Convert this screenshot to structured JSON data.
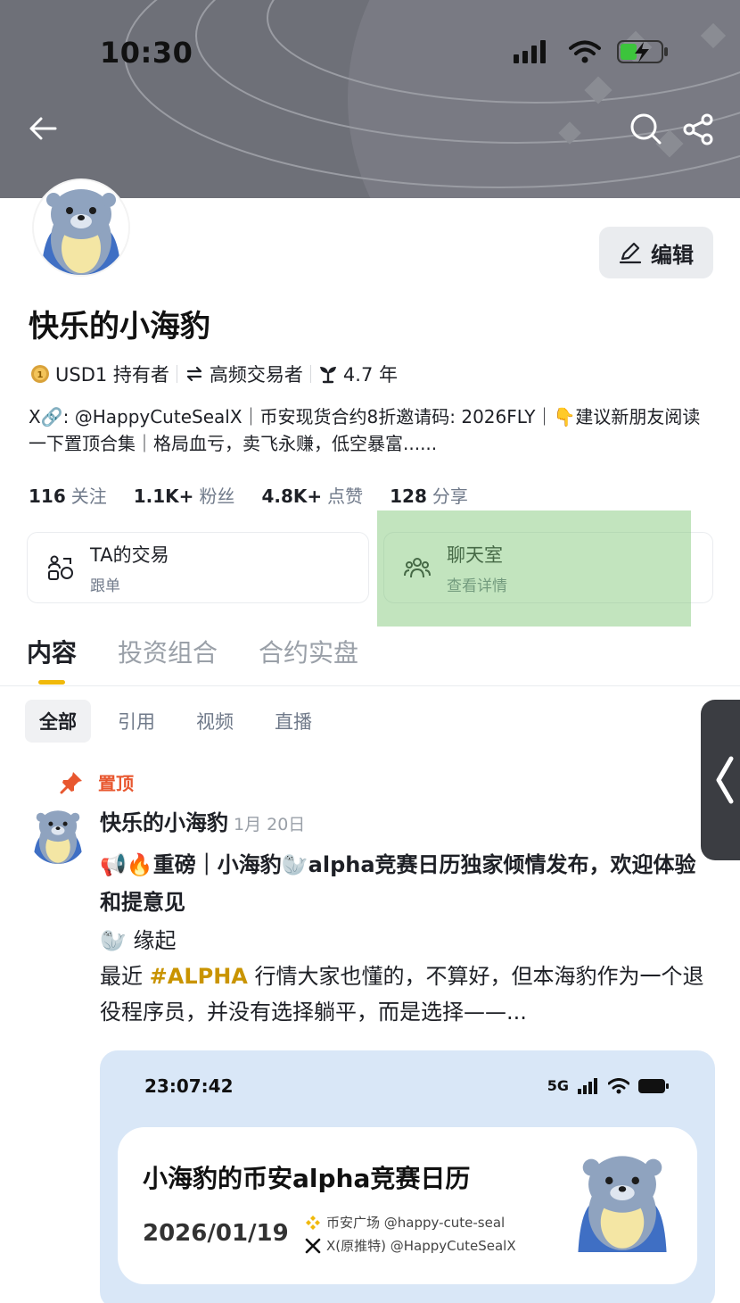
{
  "status_bar": {
    "time": "10:30"
  },
  "profile": {
    "name": "快乐的小海豹",
    "edit_label": "编辑",
    "badges": [
      {
        "icon": "coin-icon",
        "label": "USD1 持有者"
      },
      {
        "icon": "exchange-icon",
        "label": "高频交易者"
      },
      {
        "icon": "sprout-icon",
        "label": "4.7 年"
      }
    ],
    "bio": "X🔗: @HappyCuteSealX｜币安现货合约8折邀请码: 2026FLY｜👇建议新朋友阅读一下置顶合集｜格局血亏，卖飞永赚，低空暴富......",
    "stats": [
      {
        "value": "116",
        "label": "关注"
      },
      {
        "value": "1.1K+",
        "label": "粉丝"
      },
      {
        "value": "4.8K+",
        "label": "点赞"
      },
      {
        "value": "128",
        "label": "分享"
      }
    ]
  },
  "cards": [
    {
      "title": "TA的交易",
      "subtitle": "跟单"
    },
    {
      "title": "聊天室",
      "subtitle": "查看详情"
    }
  ],
  "tabs": [
    "内容",
    "投资组合",
    "合约实盘"
  ],
  "filters": [
    "全部",
    "引用",
    "视频",
    "直播"
  ],
  "post": {
    "pinned_label": "置顶",
    "author": "快乐的小海豹",
    "date": "1月 20日",
    "title": "📢🔥重磅｜小海豹🦭alpha竞赛日历独家倾情发布，欢迎体验和提意见",
    "subtitle": "🦭 缘起",
    "body_prefix": "最近 ",
    "hashtag": "#ALPHA",
    "body_suffix": " 行情大家也懂的，不算好，但本海豹作为一个退役程序员，并没有选择躺平，而是选择——...",
    "media": {
      "time": "23:07:42",
      "network": "5G",
      "title": "小海豹的币安alpha竞赛日历",
      "date": "2026/01/19",
      "line1": "币安广场 @happy-cute-seal",
      "line2": "X(原推特) @HappyCuteSealX"
    }
  },
  "colors": {
    "accent": "#f0b90b",
    "hashtag": "#c99400",
    "pin": "#e8572f",
    "highlight": "#78c36e"
  }
}
